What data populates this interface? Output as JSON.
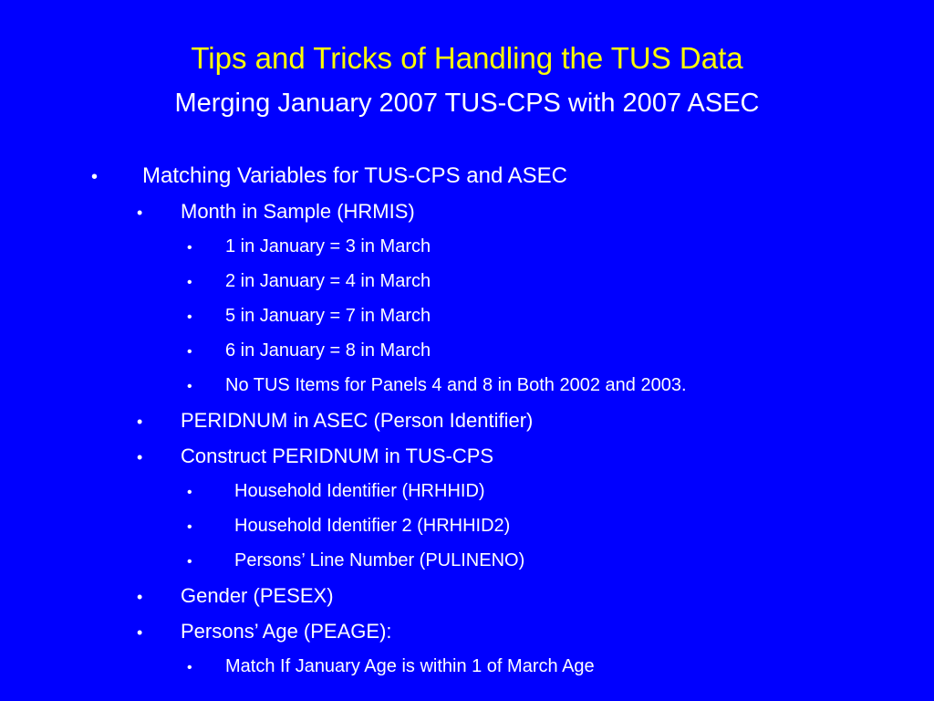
{
  "slide": {
    "title_main": "Tips and Tricks of Handling the TUS Data",
    "title_sub": "Merging January 2007 TUS-CPS with 2007 ASEC",
    "bullet_glyph": "•",
    "colors": {
      "background": "#0000FF",
      "title": "#FFFF00",
      "text": "#FFFFFF"
    },
    "items": [
      {
        "level": 1,
        "text": "Matching Variables for TUS-CPS and ASEC"
      },
      {
        "level": 2,
        "text": "Month in Sample (HRMIS)"
      },
      {
        "level": 3,
        "text": "1 in January = 3 in March"
      },
      {
        "level": 3,
        "text": "2 in January = 4 in March"
      },
      {
        "level": 3,
        "text": "5 in January = 7 in March"
      },
      {
        "level": 3,
        "text": "6 in January = 8 in March"
      },
      {
        "level": 3,
        "text": "No TUS Items for Panels 4 and 8 in Both 2002 and 2003."
      },
      {
        "level": 2,
        "text": "PERIDNUM in ASEC (Person Identifier)"
      },
      {
        "level": 2,
        "text": "Construct PERIDNUM in TUS-CPS"
      },
      {
        "level": 3,
        "wide": true,
        "text": "Household Identifier (HRHHID)"
      },
      {
        "level": 3,
        "wide": true,
        "text": "Household Identifier 2 (HRHHID2)"
      },
      {
        "level": 3,
        "wide": true,
        "text": "Persons’ Line Number (PULINENO)"
      },
      {
        "level": 2,
        "text": "Gender (PESEX)"
      },
      {
        "level": 2,
        "text": "Persons’ Age (PEAGE):"
      },
      {
        "level": 3,
        "text": "Match If January Age is within 1 of March Age"
      }
    ]
  }
}
